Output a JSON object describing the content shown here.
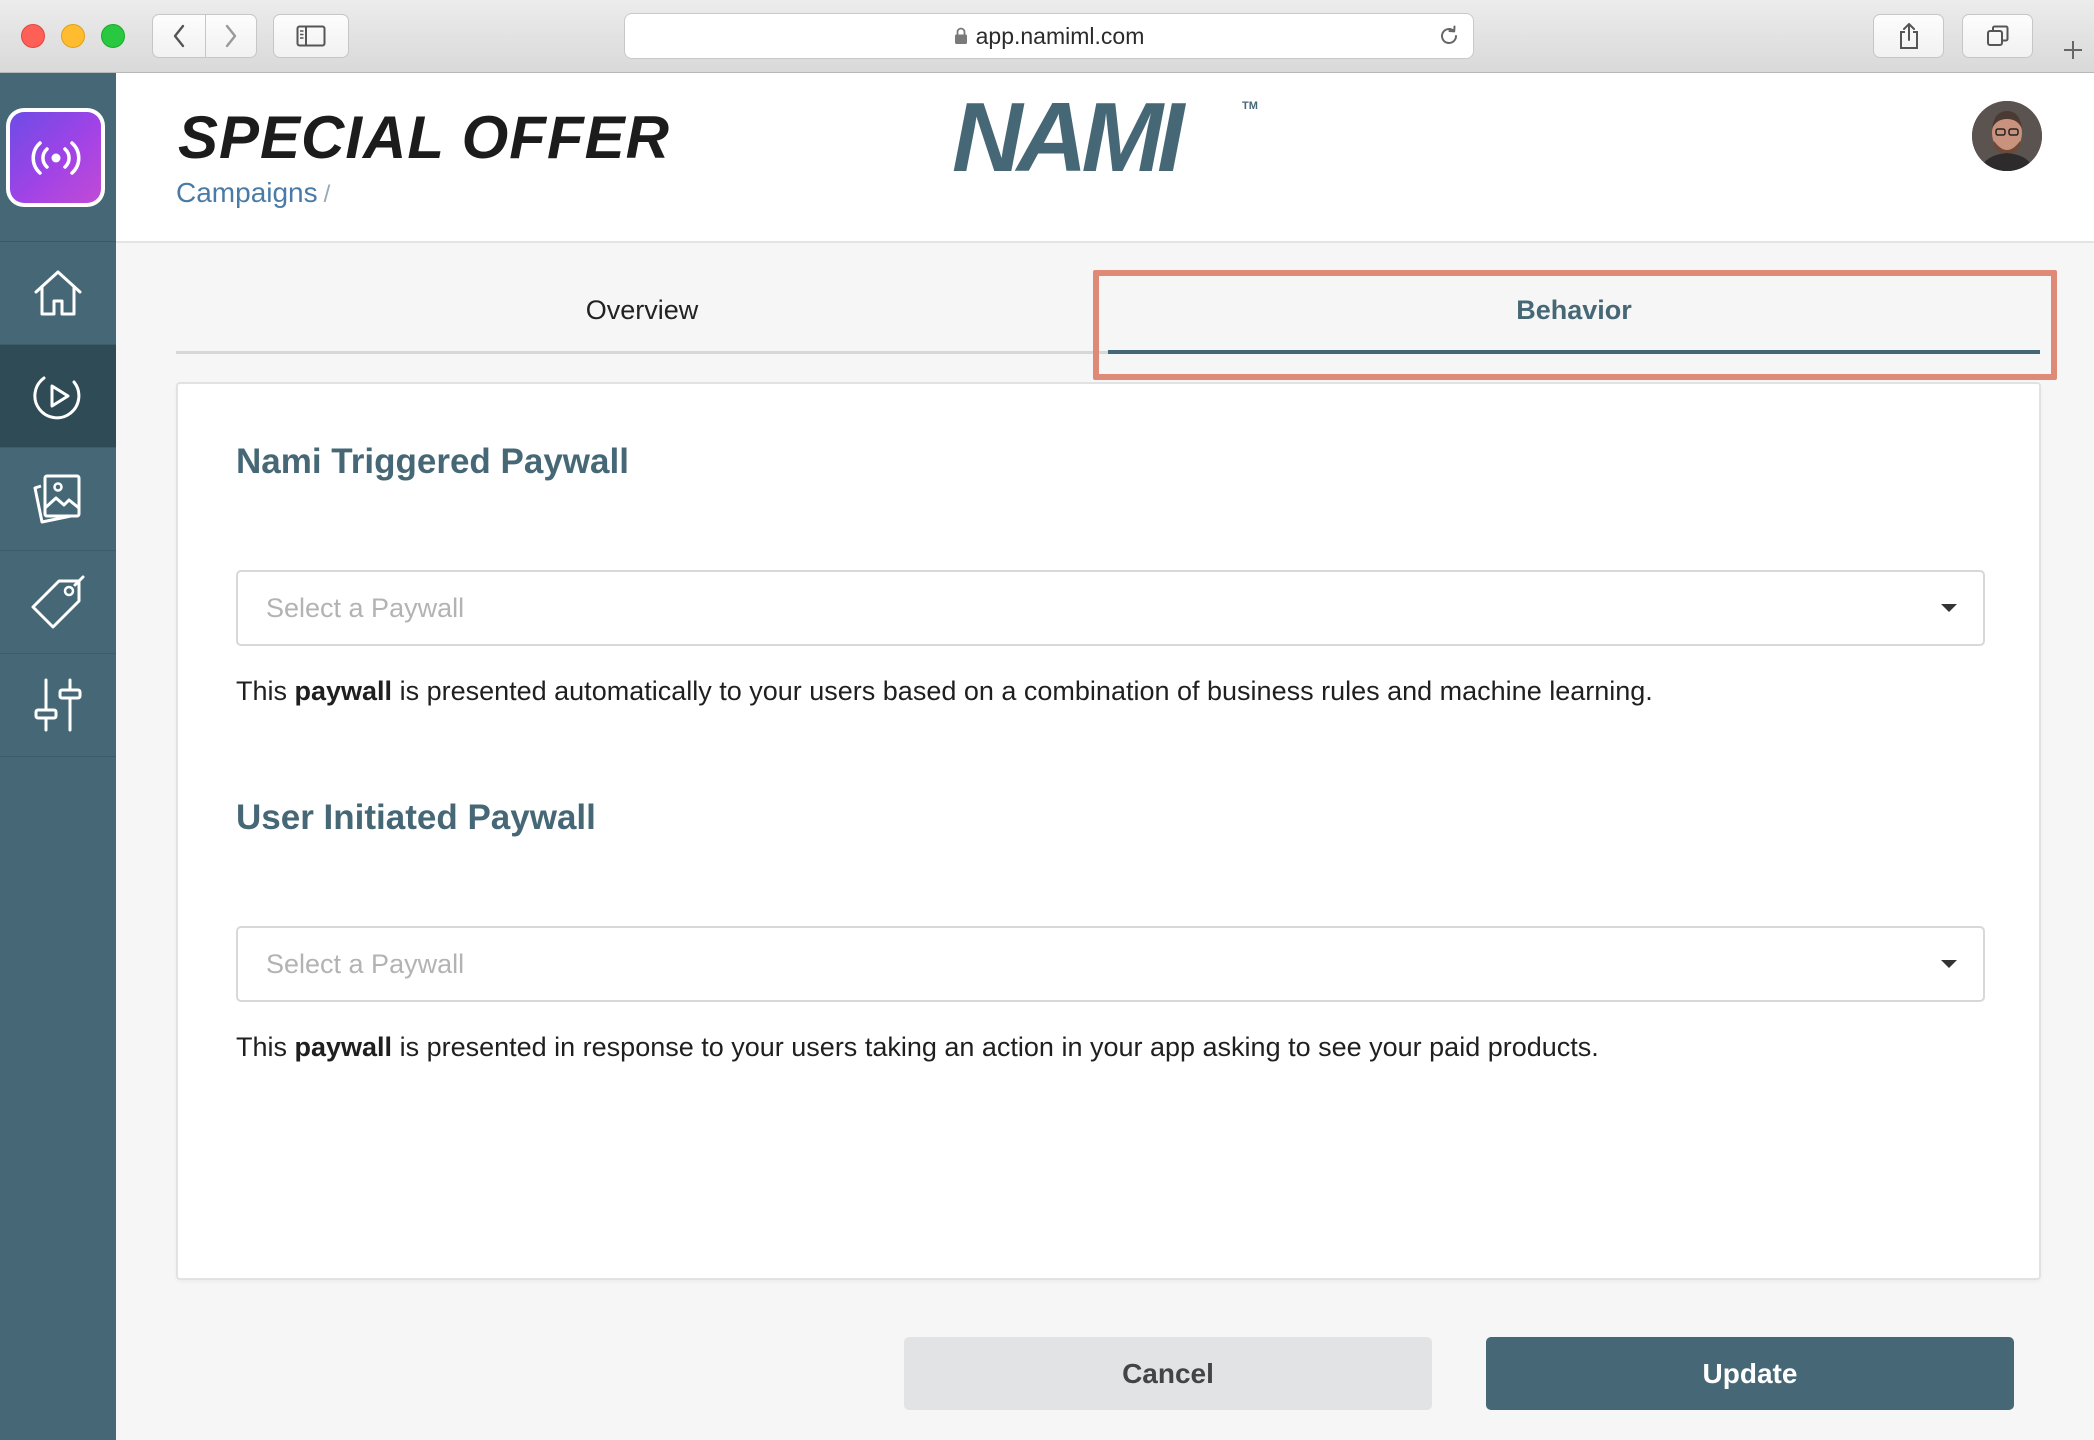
{
  "browser": {
    "url": "app.namiml.com"
  },
  "header": {
    "title": "SPECIAL OFFER",
    "breadcrumb": "Campaigns",
    "breadcrumb_sep": "/",
    "logo_text": "NAMI",
    "logo_tm": "TM"
  },
  "tabs": [
    {
      "label": "Overview",
      "active": false
    },
    {
      "label": "Behavior",
      "active": true
    }
  ],
  "sections": {
    "triggered": {
      "title": "Nami Triggered Paywall",
      "placeholder": "Select a Paywall",
      "desc_pre": "This ",
      "desc_bold": "paywall",
      "desc_post": " is presented automatically to your users based on a combination of business rules and machine learning."
    },
    "user": {
      "title": "User Initiated Paywall",
      "placeholder": "Select a Paywall",
      "desc_pre": "This ",
      "desc_bold": "paywall",
      "desc_post": " is presented in response to your users taking an action in your app asking to see your paid products."
    },
    "highlighted_tab": "Behavior"
  },
  "buttons": {
    "cancel": "Cancel",
    "update": "Update"
  },
  "rail": {
    "items": [
      "home-icon",
      "campaign-play-icon",
      "paywall-images-icon",
      "products-tag-icon",
      "settings-sliders-icon"
    ],
    "active": "campaign-play-icon"
  },
  "colors": {
    "accent": "#466876",
    "link": "#4a7ba6",
    "highlight": "#df8a77",
    "app_badge": "#a143e6"
  }
}
